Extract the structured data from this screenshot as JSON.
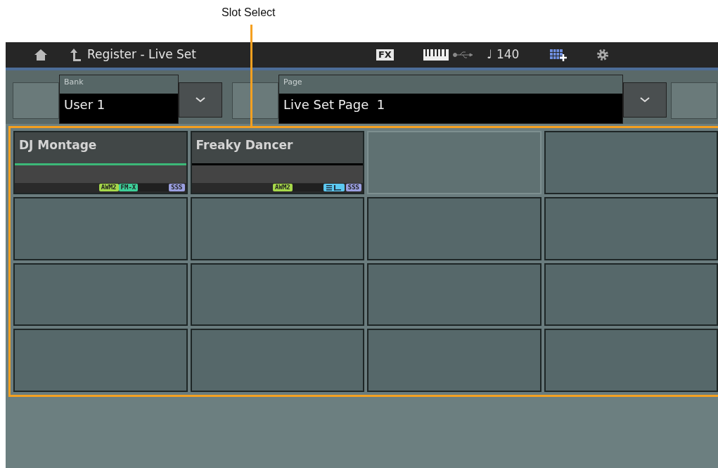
{
  "callout": {
    "label": "Slot Select"
  },
  "header": {
    "title": "Register - Live Set",
    "fx": "FX",
    "tempo_note": "♩",
    "tempo": "140"
  },
  "bank": {
    "label": "Bank",
    "value": "User 1"
  },
  "page": {
    "label": "Page",
    "value": "Live Set Page  1"
  },
  "slots": [
    {
      "name": "DJ Montage",
      "current": true,
      "selected": false,
      "tags": [
        {
          "kind": "text",
          "label": "AWM2",
          "color": "#a6d84a"
        },
        {
          "kind": "text",
          "label": "FM-X",
          "color": "#3cce98"
        },
        {
          "kind": "gap"
        },
        {
          "kind": "text",
          "label": "SSS",
          "color": "#9a9fe0"
        }
      ]
    },
    {
      "name": "Freaky Dancer",
      "current": false,
      "selected": false,
      "tags": [
        {
          "kind": "text",
          "label": "AWM2",
          "color": "#a6d84a"
        },
        {
          "kind": "gap"
        },
        {
          "kind": "icon",
          "color": "#5cc8f0"
        },
        {
          "kind": "text",
          "label": "SSS",
          "color": "#9a9fe0"
        }
      ]
    },
    {
      "selected": true
    },
    {
      "selected": false
    },
    {
      "selected": false
    },
    {
      "selected": false
    },
    {
      "selected": false
    },
    {
      "selected": false
    },
    {
      "selected": false
    },
    {
      "selected": false
    },
    {
      "selected": false
    },
    {
      "selected": false
    },
    {
      "selected": false
    },
    {
      "selected": false
    },
    {
      "selected": false
    },
    {
      "selected": false
    }
  ]
}
